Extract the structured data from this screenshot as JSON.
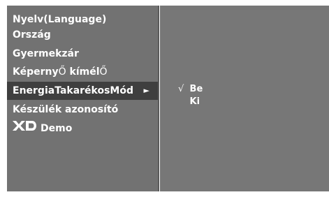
{
  "menu": {
    "items": [
      {
        "label": "Nyelv(Language)"
      },
      {
        "label": "Ország"
      },
      {
        "label": "Gyermekzár"
      },
      {
        "label_part1": "Képerny",
        "label_part2": "Ő",
        "label_part3": " kímél",
        "label_part4": "Ő"
      },
      {
        "label": "EnergiaTakarékosMód",
        "selected": true,
        "arrow": "►"
      },
      {
        "label": "Készülék azonosító"
      },
      {
        "logo": "XD",
        "label": "Demo"
      }
    ]
  },
  "submenu": {
    "options": [
      {
        "check": "√",
        "label": "Be",
        "checked": true
      },
      {
        "check": "",
        "label": "Ki",
        "checked": false
      }
    ]
  },
  "colors": {
    "left_panel": "#727272",
    "right_panel": "#777777",
    "selected_row": "#3f3f3f",
    "text": "#ffffff"
  },
  "icons": {
    "submenu_arrow": "right-triangle-icon",
    "xd_logo": "xd-logo-icon",
    "check": "checkmark-icon"
  }
}
